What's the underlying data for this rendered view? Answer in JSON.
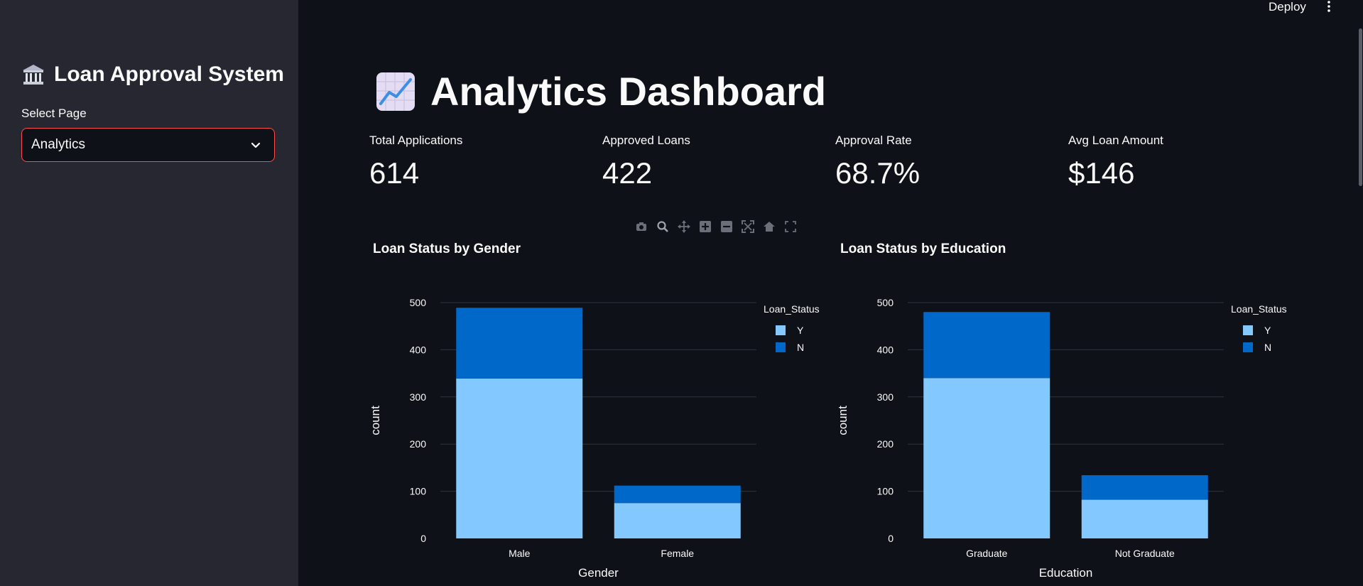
{
  "sidebar": {
    "title": "Loan Approval System",
    "select_label": "Select Page",
    "select_value": "Analytics"
  },
  "header": {
    "deploy_label": "Deploy"
  },
  "page": {
    "title": "Analytics Dashboard"
  },
  "metrics": [
    {
      "label": "Total Applications",
      "value": "614"
    },
    {
      "label": "Approved Loans",
      "value": "422"
    },
    {
      "label": "Approval Rate",
      "value": "68.7%"
    },
    {
      "label": "Avg Loan Amount",
      "value": "$146"
    }
  ],
  "colors": {
    "accent": "#ff4b4b",
    "series_y": "#83c9ff",
    "series_n": "#0068c9"
  },
  "chart_data": [
    {
      "type": "bar",
      "stacked": true,
      "title": "Loan Status by Gender",
      "xlabel": "Gender",
      "ylabel": "count",
      "ylim": [
        0,
        500
      ],
      "yticks": [
        0,
        100,
        200,
        300,
        400,
        500
      ],
      "categories": [
        "Male",
        "Female"
      ],
      "legend_title": "Loan_Status",
      "legend_position": "right",
      "series": [
        {
          "name": "Y",
          "values": [
            339,
            75
          ],
          "color": "#83c9ff"
        },
        {
          "name": "N",
          "values": [
            150,
            37
          ],
          "color": "#0068c9"
        }
      ]
    },
    {
      "type": "bar",
      "stacked": true,
      "title": "Loan Status by Education",
      "xlabel": "Education",
      "ylabel": "count",
      "ylim": [
        0,
        500
      ],
      "yticks": [
        0,
        100,
        200,
        300,
        400,
        500
      ],
      "categories": [
        "Graduate",
        "Not Graduate"
      ],
      "legend_title": "Loan_Status",
      "legend_position": "right",
      "series": [
        {
          "name": "Y",
          "values": [
            340,
            82
          ],
          "color": "#83c9ff"
        },
        {
          "name": "N",
          "values": [
            140,
            52
          ],
          "color": "#0068c9"
        }
      ]
    }
  ]
}
